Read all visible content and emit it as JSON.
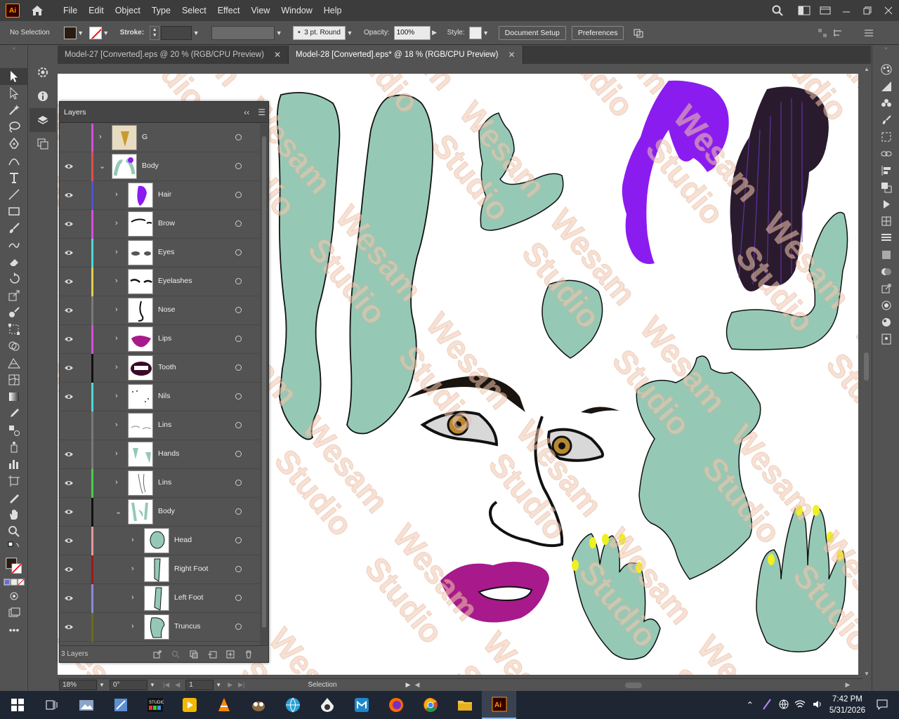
{
  "app": {
    "logo_text": "Ai"
  },
  "menu": [
    "File",
    "Edit",
    "Object",
    "Type",
    "Select",
    "Effect",
    "View",
    "Window",
    "Help"
  ],
  "control_bar": {
    "selection_status": "No Selection",
    "stroke_label": "Stroke:",
    "brush_profile": "3 pt. Round",
    "opacity_label": "Opacity:",
    "opacity_value": "100%",
    "style_label": "Style:",
    "document_setup": "Document Setup",
    "preferences": "Preferences"
  },
  "tabs": [
    {
      "label": "Model-27 [Converted].eps @ 20 % (RGB/CPU Preview)",
      "close": "✕"
    },
    {
      "label": "Model-28 [Converted].eps* @ 18 % (RGB/CPU Preview)",
      "close": "✕"
    }
  ],
  "layers_panel": {
    "title": "Layers",
    "layers": [
      {
        "name": "G",
        "color": "#d94cd9",
        "visible": false
      },
      {
        "name": "Body",
        "color": "#e0504a",
        "visible": true
      },
      {
        "name": "Hair",
        "color": "#4d52d8",
        "visible": true
      },
      {
        "name": "Brow",
        "color": "#d94cd9",
        "visible": true
      },
      {
        "name": "Eyes",
        "color": "#4fd8d8",
        "visible": true
      },
      {
        "name": "Eyelashes",
        "color": "#e0d04a",
        "visible": true
      },
      {
        "name": "Nose",
        "color": "#7a7a7a",
        "visible": true
      },
      {
        "name": "Lips",
        "color": "#d94cd9",
        "visible": true
      },
      {
        "name": "Tooth",
        "color": "#111111",
        "visible": true
      },
      {
        "name": "Nils",
        "color": "#4fd8d8",
        "visible": true
      },
      {
        "name": "Lins",
        "color": "#7a7a7a",
        "visible": false
      },
      {
        "name": "Hands",
        "color": "#7a7a7a",
        "visible": true
      },
      {
        "name": "Lins",
        "color": "#4ccc4c",
        "visible": true
      },
      {
        "name": "Body",
        "color": "#111111",
        "visible": true
      },
      {
        "name": "Head",
        "color": "#e39a9a",
        "visible": true
      },
      {
        "name": "Right Foot",
        "color": "#a01818",
        "visible": true
      },
      {
        "name": "Left Foot",
        "color": "#8a8adc",
        "visible": true
      },
      {
        "name": "Truncus",
        "color": "#6e6a1a",
        "visible": true
      }
    ],
    "footer_count": "3 Layers"
  },
  "status_bar": {
    "zoom": "18%",
    "rotation": "0°",
    "artboard": "1",
    "tool": "Selection"
  },
  "taskbar": {
    "time": "7:42 PM",
    "date": "5/31/2026"
  },
  "colors": {
    "skin": "#95c9b6",
    "hair_purple": "#8a1cf0",
    "lips": "#a8198b",
    "nails": "#f0f020"
  },
  "watermark": "Wesam Studio"
}
